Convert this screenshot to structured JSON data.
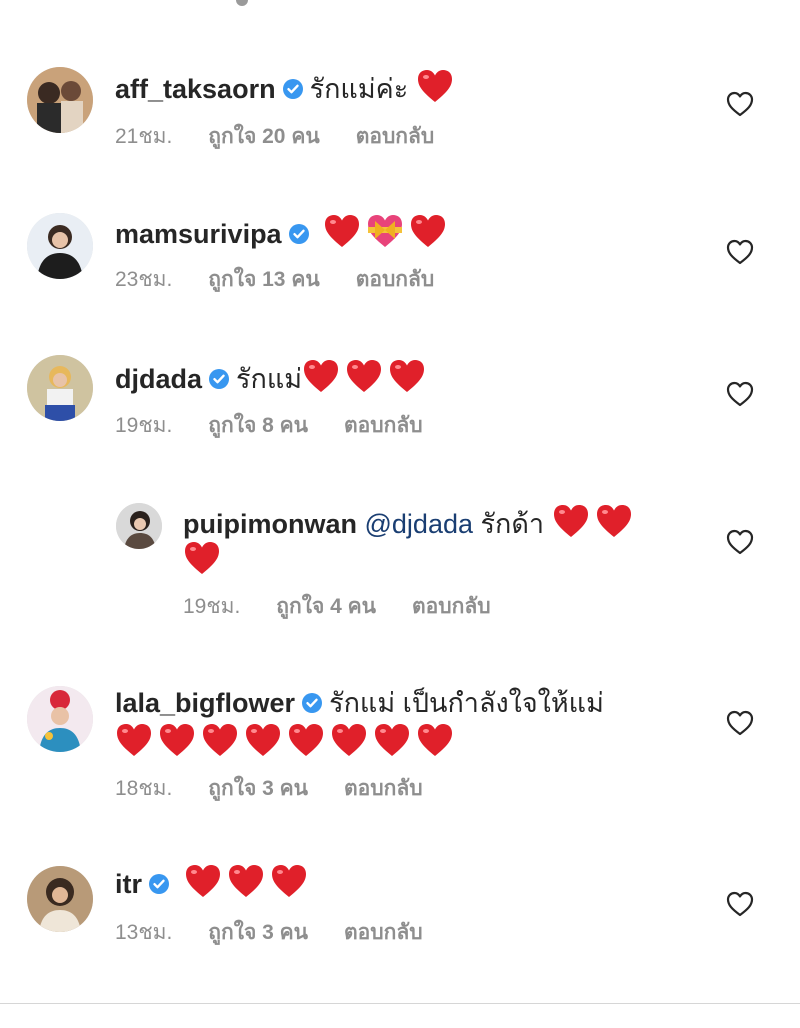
{
  "comments": [
    {
      "username": "aff_taksaorn",
      "verified": true,
      "text": "รักแม่ค่ะ",
      "hearts": 1,
      "time": "21ชม.",
      "likes": "ถูกใจ 20 คน",
      "reply": "ตอบกลับ",
      "like_icon": "heart-outline-icon"
    },
    {
      "username": "mamsurivipa",
      "verified": true,
      "text": "",
      "emoji": [
        "red-heart",
        "heart-with-ribbon",
        "red-heart"
      ],
      "time": "23ชม.",
      "likes": "ถูกใจ 13 คน",
      "reply": "ตอบกลับ",
      "like_icon": "heart-outline-icon"
    },
    {
      "username": "djdada",
      "verified": true,
      "text": "รักแม่",
      "hearts": 3,
      "time": "19ชม.",
      "likes": "ถูกใจ 8 คน",
      "reply": "ตอบกลับ",
      "like_icon": "heart-outline-icon",
      "replies": [
        {
          "username": "puipimonwan",
          "verified": false,
          "mention": "@djdada",
          "text": "รักด้า",
          "hearts": 3,
          "time": "19ชม.",
          "likes": "ถูกใจ 4 คน",
          "reply": "ตอบกลับ",
          "like_icon": "heart-outline-icon"
        }
      ]
    },
    {
      "username": "lala_bigflower",
      "verified": true,
      "text": "รักแม่ เป็นกำลังใจให้แม่",
      "hearts": 8,
      "time": "18ชม.",
      "likes": "ถูกใจ 3 คน",
      "reply": "ตอบกลับ",
      "like_icon": "heart-outline-icon"
    },
    {
      "username": "itr",
      "verified": true,
      "text": "",
      "hearts": 3,
      "time": "13ชม.",
      "likes": "ถูกใจ 3 คน",
      "reply": "ตอบกลับ",
      "like_icon": "heart-outline-icon"
    }
  ],
  "colors": {
    "heart_red": "#e0202a",
    "verified_blue": "#3897f0",
    "meta_gray": "#8e8e8e",
    "mention_blue": "#1a3e72"
  }
}
